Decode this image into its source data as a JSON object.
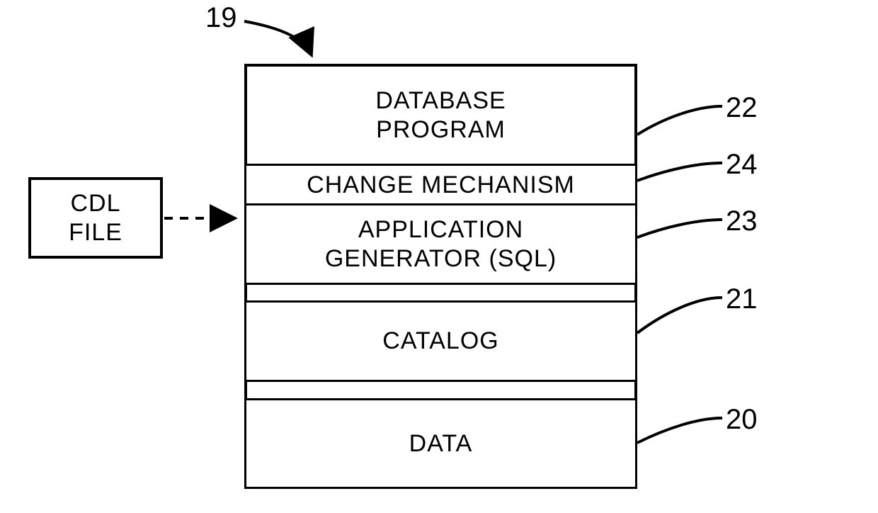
{
  "cdl_file": {
    "line1": "CDL",
    "line2": "FILE"
  },
  "stack": {
    "rows": [
      {
        "line1": "DATABASE",
        "line2": "PROGRAM"
      },
      {
        "line1": "CHANGE MECHANISM"
      },
      {
        "line1": "APPLICATION",
        "line2": "GENERATOR (SQL)"
      },
      {
        "line1": "CATALOG"
      },
      {
        "line1": "DATA"
      }
    ]
  },
  "refs": {
    "top": "19",
    "r0": "22",
    "r1": "24",
    "r2": "23",
    "r3": "21",
    "r4": "20"
  }
}
